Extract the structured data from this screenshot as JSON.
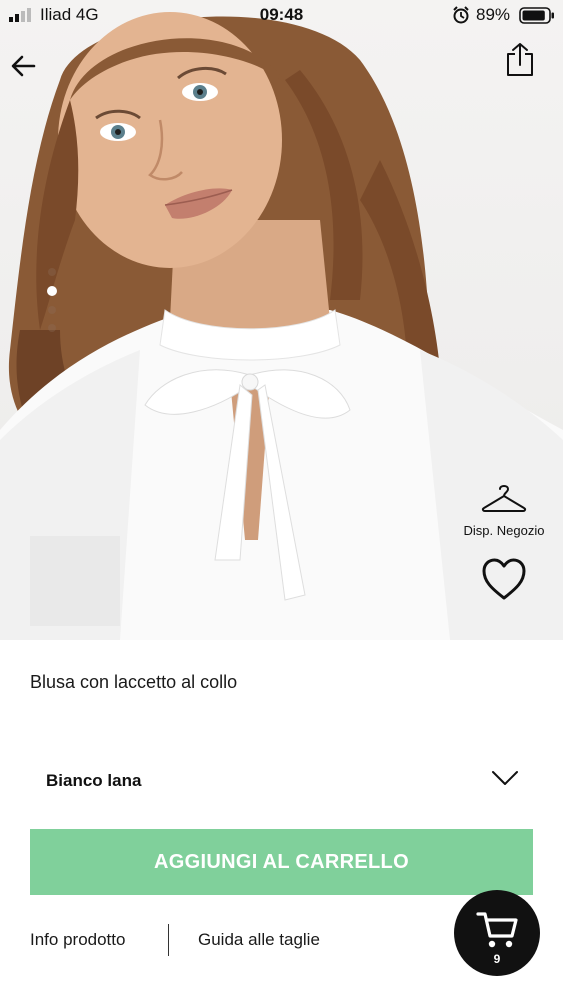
{
  "status_bar": {
    "carrier": "Iliad 4G",
    "time": "09:48",
    "battery": "89%",
    "battery_level": 0.89
  },
  "header": {
    "back_icon": "arrow-left-icon",
    "share_icon": "share-icon"
  },
  "gallery": {
    "image_count": 4,
    "active_index": 1
  },
  "actions": {
    "store_availability_label": "Disp. Negozio",
    "store_icon": "hanger-icon",
    "wishlist_icon": "heart-icon"
  },
  "product": {
    "title": "Blusa con laccetto al collo",
    "selected_color": "Bianco lana"
  },
  "buttons": {
    "add_to_cart": "AGGIUNGI AL CARRELLO",
    "add_to_cart_color": "#80d09b"
  },
  "links": {
    "info": "Info prodotto",
    "size_guide": "Guida alle taglie"
  },
  "cart": {
    "count": "9",
    "icon": "cart-icon"
  }
}
